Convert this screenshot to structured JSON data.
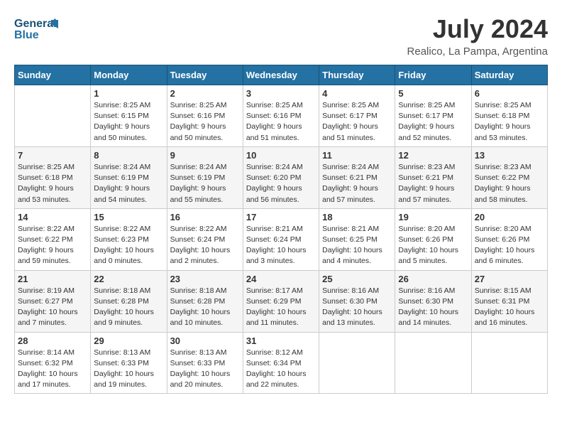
{
  "logo": {
    "line1": "General",
    "line2": "Blue"
  },
  "title": "July 2024",
  "location": "Realico, La Pampa, Argentina",
  "days_of_week": [
    "Sunday",
    "Monday",
    "Tuesday",
    "Wednesday",
    "Thursday",
    "Friday",
    "Saturday"
  ],
  "weeks": [
    [
      {
        "day": "",
        "sunrise": "",
        "sunset": "",
        "daylight": ""
      },
      {
        "day": "1",
        "sunrise": "Sunrise: 8:25 AM",
        "sunset": "Sunset: 6:15 PM",
        "daylight": "Daylight: 9 hours and 50 minutes."
      },
      {
        "day": "2",
        "sunrise": "Sunrise: 8:25 AM",
        "sunset": "Sunset: 6:16 PM",
        "daylight": "Daylight: 9 hours and 50 minutes."
      },
      {
        "day": "3",
        "sunrise": "Sunrise: 8:25 AM",
        "sunset": "Sunset: 6:16 PM",
        "daylight": "Daylight: 9 hours and 51 minutes."
      },
      {
        "day": "4",
        "sunrise": "Sunrise: 8:25 AM",
        "sunset": "Sunset: 6:17 PM",
        "daylight": "Daylight: 9 hours and 51 minutes."
      },
      {
        "day": "5",
        "sunrise": "Sunrise: 8:25 AM",
        "sunset": "Sunset: 6:17 PM",
        "daylight": "Daylight: 9 hours and 52 minutes."
      },
      {
        "day": "6",
        "sunrise": "Sunrise: 8:25 AM",
        "sunset": "Sunset: 6:18 PM",
        "daylight": "Daylight: 9 hours and 53 minutes."
      }
    ],
    [
      {
        "day": "7",
        "sunrise": "Sunrise: 8:25 AM",
        "sunset": "Sunset: 6:18 PM",
        "daylight": "Daylight: 9 hours and 53 minutes."
      },
      {
        "day": "8",
        "sunrise": "Sunrise: 8:24 AM",
        "sunset": "Sunset: 6:19 PM",
        "daylight": "Daylight: 9 hours and 54 minutes."
      },
      {
        "day": "9",
        "sunrise": "Sunrise: 8:24 AM",
        "sunset": "Sunset: 6:19 PM",
        "daylight": "Daylight: 9 hours and 55 minutes."
      },
      {
        "day": "10",
        "sunrise": "Sunrise: 8:24 AM",
        "sunset": "Sunset: 6:20 PM",
        "daylight": "Daylight: 9 hours and 56 minutes."
      },
      {
        "day": "11",
        "sunrise": "Sunrise: 8:24 AM",
        "sunset": "Sunset: 6:21 PM",
        "daylight": "Daylight: 9 hours and 57 minutes."
      },
      {
        "day": "12",
        "sunrise": "Sunrise: 8:23 AM",
        "sunset": "Sunset: 6:21 PM",
        "daylight": "Daylight: 9 hours and 57 minutes."
      },
      {
        "day": "13",
        "sunrise": "Sunrise: 8:23 AM",
        "sunset": "Sunset: 6:22 PM",
        "daylight": "Daylight: 9 hours and 58 minutes."
      }
    ],
    [
      {
        "day": "14",
        "sunrise": "Sunrise: 8:22 AM",
        "sunset": "Sunset: 6:22 PM",
        "daylight": "Daylight: 9 hours and 59 minutes."
      },
      {
        "day": "15",
        "sunrise": "Sunrise: 8:22 AM",
        "sunset": "Sunset: 6:23 PM",
        "daylight": "Daylight: 10 hours and 0 minutes."
      },
      {
        "day": "16",
        "sunrise": "Sunrise: 8:22 AM",
        "sunset": "Sunset: 6:24 PM",
        "daylight": "Daylight: 10 hours and 2 minutes."
      },
      {
        "day": "17",
        "sunrise": "Sunrise: 8:21 AM",
        "sunset": "Sunset: 6:24 PM",
        "daylight": "Daylight: 10 hours and 3 minutes."
      },
      {
        "day": "18",
        "sunrise": "Sunrise: 8:21 AM",
        "sunset": "Sunset: 6:25 PM",
        "daylight": "Daylight: 10 hours and 4 minutes."
      },
      {
        "day": "19",
        "sunrise": "Sunrise: 8:20 AM",
        "sunset": "Sunset: 6:26 PM",
        "daylight": "Daylight: 10 hours and 5 minutes."
      },
      {
        "day": "20",
        "sunrise": "Sunrise: 8:20 AM",
        "sunset": "Sunset: 6:26 PM",
        "daylight": "Daylight: 10 hours and 6 minutes."
      }
    ],
    [
      {
        "day": "21",
        "sunrise": "Sunrise: 8:19 AM",
        "sunset": "Sunset: 6:27 PM",
        "daylight": "Daylight: 10 hours and 7 minutes."
      },
      {
        "day": "22",
        "sunrise": "Sunrise: 8:18 AM",
        "sunset": "Sunset: 6:28 PM",
        "daylight": "Daylight: 10 hours and 9 minutes."
      },
      {
        "day": "23",
        "sunrise": "Sunrise: 8:18 AM",
        "sunset": "Sunset: 6:28 PM",
        "daylight": "Daylight: 10 hours and 10 minutes."
      },
      {
        "day": "24",
        "sunrise": "Sunrise: 8:17 AM",
        "sunset": "Sunset: 6:29 PM",
        "daylight": "Daylight: 10 hours and 11 minutes."
      },
      {
        "day": "25",
        "sunrise": "Sunrise: 8:16 AM",
        "sunset": "Sunset: 6:30 PM",
        "daylight": "Daylight: 10 hours and 13 minutes."
      },
      {
        "day": "26",
        "sunrise": "Sunrise: 8:16 AM",
        "sunset": "Sunset: 6:30 PM",
        "daylight": "Daylight: 10 hours and 14 minutes."
      },
      {
        "day": "27",
        "sunrise": "Sunrise: 8:15 AM",
        "sunset": "Sunset: 6:31 PM",
        "daylight": "Daylight: 10 hours and 16 minutes."
      }
    ],
    [
      {
        "day": "28",
        "sunrise": "Sunrise: 8:14 AM",
        "sunset": "Sunset: 6:32 PM",
        "daylight": "Daylight: 10 hours and 17 minutes."
      },
      {
        "day": "29",
        "sunrise": "Sunrise: 8:13 AM",
        "sunset": "Sunset: 6:33 PM",
        "daylight": "Daylight: 10 hours and 19 minutes."
      },
      {
        "day": "30",
        "sunrise": "Sunrise: 8:13 AM",
        "sunset": "Sunset: 6:33 PM",
        "daylight": "Daylight: 10 hours and 20 minutes."
      },
      {
        "day": "31",
        "sunrise": "Sunrise: 8:12 AM",
        "sunset": "Sunset: 6:34 PM",
        "daylight": "Daylight: 10 hours and 22 minutes."
      },
      {
        "day": "",
        "sunrise": "",
        "sunset": "",
        "daylight": ""
      },
      {
        "day": "",
        "sunrise": "",
        "sunset": "",
        "daylight": ""
      },
      {
        "day": "",
        "sunrise": "",
        "sunset": "",
        "daylight": ""
      }
    ]
  ]
}
